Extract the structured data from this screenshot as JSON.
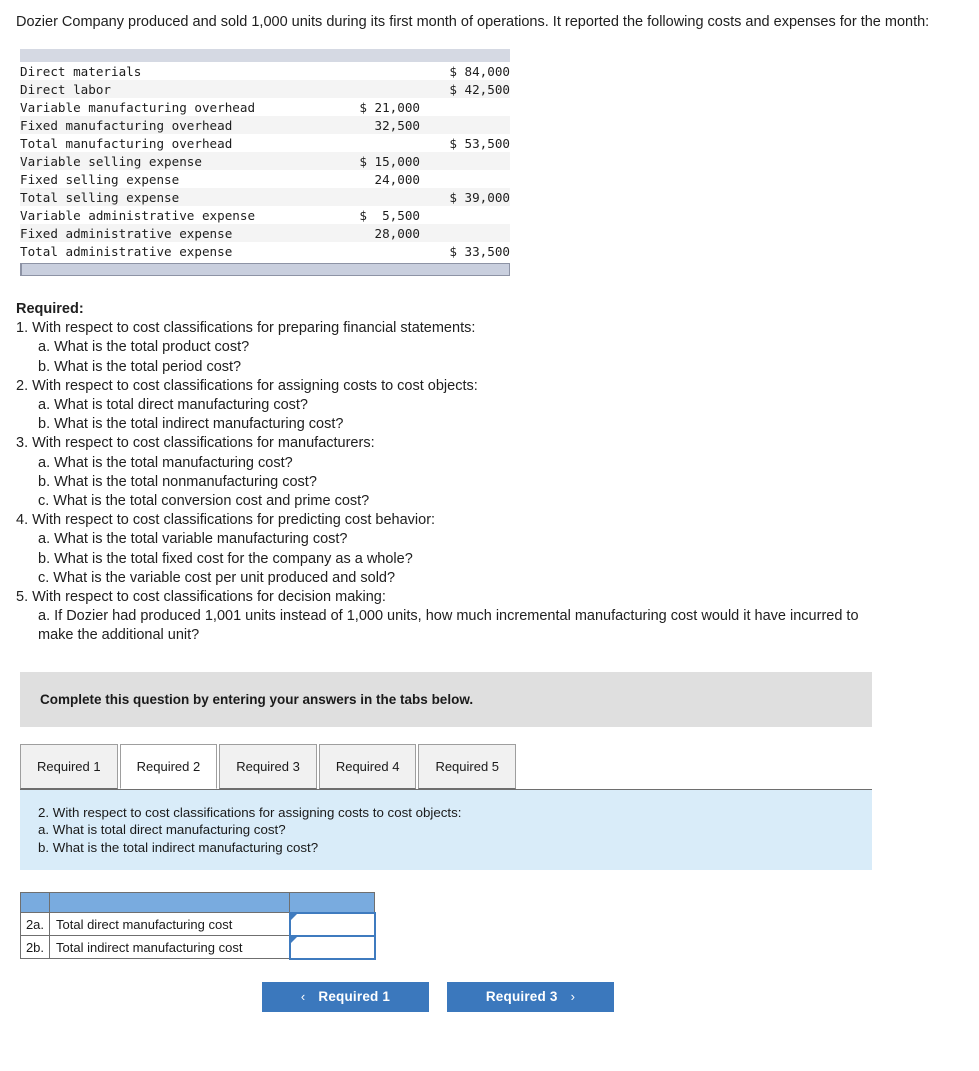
{
  "intro": "Dozier Company produced and sold 1,000 units during its first month of operations. It reported the following costs and expenses for the month:",
  "cost_table": {
    "rows": [
      {
        "label": "Direct materials",
        "mid": "",
        "right": "$ 84,000",
        "underline_mid": false
      },
      {
        "label": "Direct labor",
        "mid": "",
        "right": "$ 42,500",
        "underline_mid": false
      },
      {
        "label": "Variable manufacturing overhead",
        "mid": "$ 21,000",
        "right": "",
        "underline_mid": false
      },
      {
        "label": "Fixed manufacturing overhead",
        "mid": "32,500",
        "right": "",
        "underline_mid": true
      },
      {
        "label": "Total manufacturing overhead",
        "mid": "",
        "right": "$ 53,500",
        "underline_mid": false
      },
      {
        "label": "Variable selling expense",
        "mid": "$ 15,000",
        "right": "",
        "underline_mid": false
      },
      {
        "label": "Fixed selling expense",
        "mid": "24,000",
        "right": "",
        "underline_mid": true
      },
      {
        "label": "Total selling expense",
        "mid": "",
        "right": "$ 39,000",
        "underline_mid": false
      },
      {
        "label": "Variable administrative expense",
        "mid": "$  5,500",
        "right": "",
        "underline_mid": false
      },
      {
        "label": "Fixed administrative expense",
        "mid": "28,000",
        "right": "",
        "underline_mid": true
      },
      {
        "label": "Total administrative expense",
        "mid": "",
        "right": "$ 33,500",
        "underline_mid": false
      }
    ]
  },
  "required": {
    "title": "Required:",
    "lines": [
      {
        "level": 1,
        "text": "1. With respect to cost classifications for preparing financial statements:"
      },
      {
        "level": 2,
        "text": "a. What is the total product cost?"
      },
      {
        "level": 2,
        "text": "b. What is the total period cost?"
      },
      {
        "level": 1,
        "text": "2. With respect to cost classifications for assigning costs to cost objects:"
      },
      {
        "level": 2,
        "text": "a. What is total direct manufacturing cost?"
      },
      {
        "level": 2,
        "text": "b. What is the total indirect manufacturing cost?"
      },
      {
        "level": 1,
        "text": "3. With respect to cost classifications for manufacturers:"
      },
      {
        "level": 2,
        "text": "a. What is the total manufacturing cost?"
      },
      {
        "level": 2,
        "text": "b. What is the total nonmanufacturing cost?"
      },
      {
        "level": 2,
        "text": "c. What is the total conversion cost and prime cost?"
      },
      {
        "level": 1,
        "text": "4. With respect to cost classifications for predicting cost behavior:"
      },
      {
        "level": 2,
        "text": "a. What is the total variable manufacturing cost?"
      },
      {
        "level": 2,
        "text": "b. What is the total fixed cost for the company as a whole?"
      },
      {
        "level": 2,
        "text": "c. What is the variable cost per unit produced and sold?"
      },
      {
        "level": 1,
        "text": "5. With respect to cost classifications for decision making:"
      },
      {
        "level": 2,
        "text": "a. If Dozier had produced 1,001 units instead of 1,000 units, how much incremental manufacturing cost would it have incurred to"
      },
      {
        "level": 3,
        "text": "make the additional unit?"
      }
    ]
  },
  "banner": {
    "text": "Complete this question by entering your answers in the tabs below."
  },
  "tabs": [
    {
      "label": "Required 1",
      "active": false
    },
    {
      "label": "Required 2",
      "active": true
    },
    {
      "label": "Required 3",
      "active": false
    },
    {
      "label": "Required 4",
      "active": false
    },
    {
      "label": "Required 5",
      "active": false
    }
  ],
  "blue_panel": {
    "lines": [
      "2. With respect to cost classifications for assigning costs to cost objects:",
      "a. What is total direct manufacturing cost?",
      "b. What is the total indirect manufacturing cost?"
    ]
  },
  "answer_table": {
    "header": {
      "num": "",
      "label": "",
      "value": ""
    },
    "rows": [
      {
        "num": "2a.",
        "label": "Total direct manufacturing cost",
        "value": ""
      },
      {
        "num": "2b.",
        "label": "Total indirect manufacturing cost",
        "value": ""
      }
    ]
  },
  "nav": {
    "prev_label": "Required 1",
    "prev_chevron": "‹",
    "next_label": "Required 3",
    "next_chevron": "›"
  },
  "colors": {
    "table_header": "#d5d9e3",
    "table_footer": "#c9cfde",
    "banner_gray": "#dfdfdf",
    "panel_blue": "#d9ecf9",
    "answer_header_blue": "#79abdf",
    "button_blue": "#3b78bd",
    "input_border": "#3f7bbf"
  }
}
